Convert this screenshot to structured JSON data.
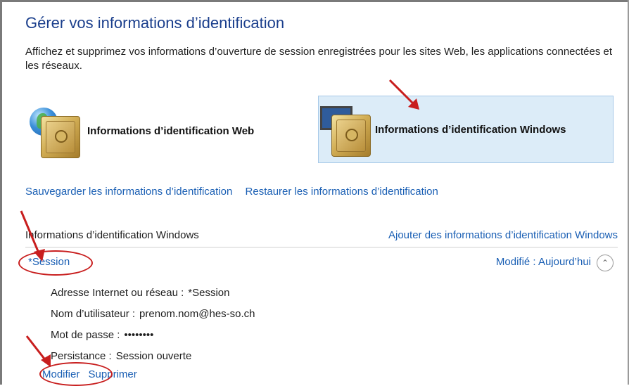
{
  "title": "Gérer vos informations d’identification",
  "description": "Affichez et supprimez vos informations d’ouverture de session enregistrées pour les sites Web, les applications connectées et les réseaux.",
  "categories": {
    "web": {
      "label": "Informations d’identification Web",
      "icon": "vault-globe-icon"
    },
    "windows": {
      "label": "Informations d’identification Windows",
      "icon": "vault-monitor-icon"
    }
  },
  "links": {
    "backup": "Sauvegarder les informations d’identification",
    "restore": "Restaurer les informations d’identification"
  },
  "section": {
    "title": "Informations d’identification Windows",
    "add": "Ajouter des informations d’identification Windows"
  },
  "entry": {
    "name": "*Session",
    "modified_label": "Modifié :",
    "modified_value": "Aujourd’hui",
    "fields": [
      {
        "label": "Adresse Internet ou réseau :",
        "value": "*Session"
      },
      {
        "label": "Nom d’utilisateur :",
        "value": "prenom.nom@hes-so.ch"
      },
      {
        "label": "Mot de passe :",
        "value": "••••••••"
      },
      {
        "label": "Persistance :",
        "value": "Session ouverte"
      }
    ],
    "actions": {
      "edit": "Modifier",
      "delete": "Supprimer"
    }
  },
  "colors": {
    "link": "#1a5fb4",
    "selected_bg": "#dcecf8",
    "annotation": "#c81e1e"
  }
}
